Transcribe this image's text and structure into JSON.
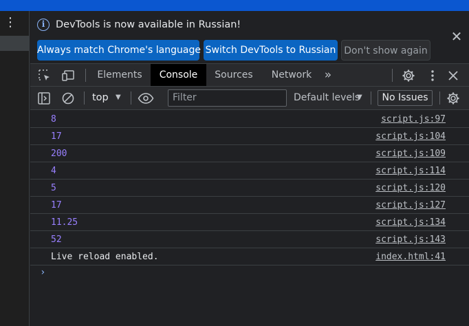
{
  "colors": {
    "accent": "#0b57d0",
    "number": "#9980ff",
    "link": "#bdc1c6"
  },
  "infobar": {
    "message": "DevTools is now available in Russian!",
    "buttons": [
      {
        "label": "Always match Chrome's language"
      },
      {
        "label": "Switch DevTools to Russian"
      },
      {
        "label": "Don't show again"
      }
    ]
  },
  "tabs": {
    "items": [
      {
        "label": "Elements"
      },
      {
        "label": "Console"
      },
      {
        "label": "Sources"
      },
      {
        "label": "Network"
      }
    ],
    "active": "Console",
    "more_label": "»"
  },
  "toolbar": {
    "context": "top",
    "filter_placeholder": "Filter",
    "levels": "Default levels",
    "issues": "No Issues"
  },
  "console": {
    "messages": [
      {
        "value": "8",
        "type": "number",
        "source": "script.js:97"
      },
      {
        "value": "17",
        "type": "number",
        "source": "script.js:104"
      },
      {
        "value": "200",
        "type": "number",
        "source": "script.js:109"
      },
      {
        "value": "4",
        "type": "number",
        "source": "script.js:114"
      },
      {
        "value": "5",
        "type": "number",
        "source": "script.js:120"
      },
      {
        "value": "17",
        "type": "number",
        "source": "script.js:127"
      },
      {
        "value": "11.25",
        "type": "number",
        "source": "script.js:134"
      },
      {
        "value": "52",
        "type": "number",
        "source": "script.js:143"
      },
      {
        "value": "Live reload enabled.",
        "type": "string",
        "source": "index.html:41"
      }
    ],
    "prompt": "›"
  },
  "icons": {
    "left_menu": "kebab-menu-icon",
    "info": "info-icon",
    "close_infobar": "close-icon",
    "inspect": "inspect-element-icon",
    "device": "device-toolbar-icon",
    "settings": "gear-icon",
    "more": "kebab-menu-icon",
    "close_devtools": "close-icon",
    "sidebar": "sidebar-toggle-icon",
    "clear": "clear-console-icon",
    "live_expression": "eye-icon",
    "console_settings": "gear-icon"
  }
}
